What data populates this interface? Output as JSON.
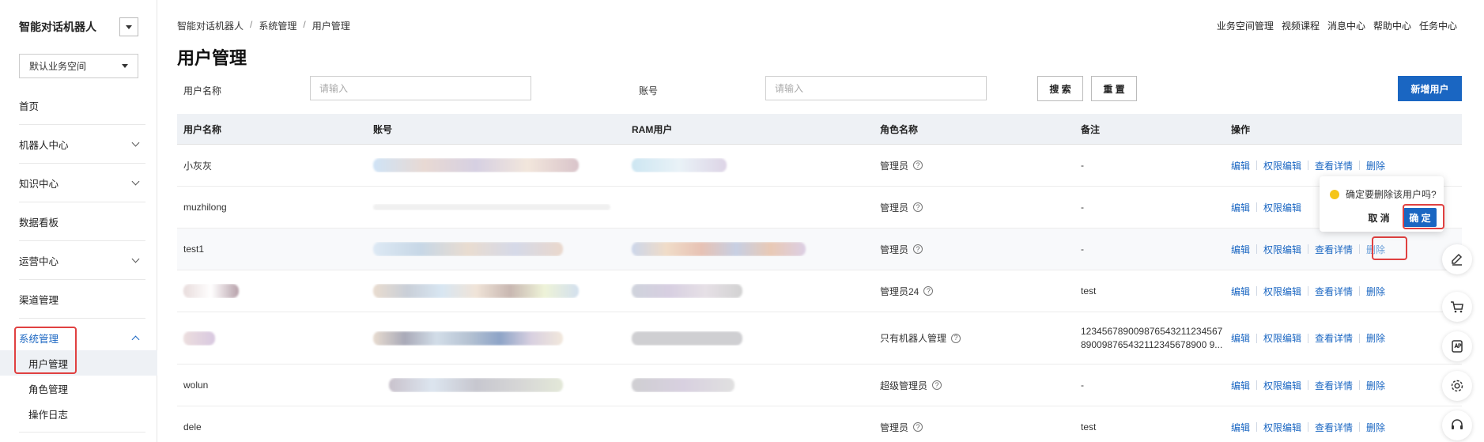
{
  "sidebar": {
    "app_title": "智能对话机器人",
    "workspace": "默认业务空间",
    "items": [
      {
        "label": "首页"
      },
      {
        "label": "机器人中心"
      },
      {
        "label": "知识中心"
      },
      {
        "label": "数据看板"
      },
      {
        "label": "运营中心"
      },
      {
        "label": "渠道管理"
      },
      {
        "label": "系统管理"
      }
    ],
    "sub_items": [
      {
        "label": "用户管理"
      },
      {
        "label": "角色管理"
      },
      {
        "label": "操作日志"
      }
    ]
  },
  "header": {
    "breadcrumb": [
      "智能对话机器人",
      "系统管理",
      "用户管理"
    ],
    "breadcrumb_sep": "/",
    "links": [
      "业务空间管理",
      "视频课程",
      "消息中心",
      "帮助中心",
      "任务中心"
    ],
    "page_title": "用户管理"
  },
  "filters": {
    "username_label": "用户名称",
    "username_placeholder": "请输入",
    "account_label": "账号",
    "account_placeholder": "请输入",
    "search_btn": "搜 索",
    "reset_btn": "重 置",
    "new_user_btn": "新增用户"
  },
  "table": {
    "columns": [
      "用户名称",
      "账号",
      "RAM用户",
      "角色名称",
      "备注",
      "操作"
    ],
    "actions": [
      "编辑",
      "权限编辑",
      "查看详情",
      "删除"
    ],
    "help_glyph": "?",
    "rows": [
      {
        "name": "小灰灰",
        "role": "管理员",
        "remark": "-"
      },
      {
        "name": "muzhilong",
        "role": "管理员",
        "remark": "-"
      },
      {
        "name": "test1",
        "role": "管理员",
        "remark": "-"
      },
      {
        "name": "",
        "role": "管理员24",
        "remark": "test"
      },
      {
        "name": "",
        "role": "只有机器人管理",
        "remark_line1": "1234567890098765432112345​67",
        "remark_line2": "890098765432112345678900 9..."
      },
      {
        "name": "wolun",
        "role": "超级管理员",
        "remark": "-"
      },
      {
        "name": "dele",
        "role": "管理员",
        "remark": "test"
      }
    ]
  },
  "popconfirm": {
    "message": "确定要删除该用户吗?",
    "cancel": "取 消",
    "ok": "确 定"
  },
  "colors": {
    "primary": "#1a66c2",
    "highlight": "#e04040",
    "warning": "#f5c518"
  }
}
